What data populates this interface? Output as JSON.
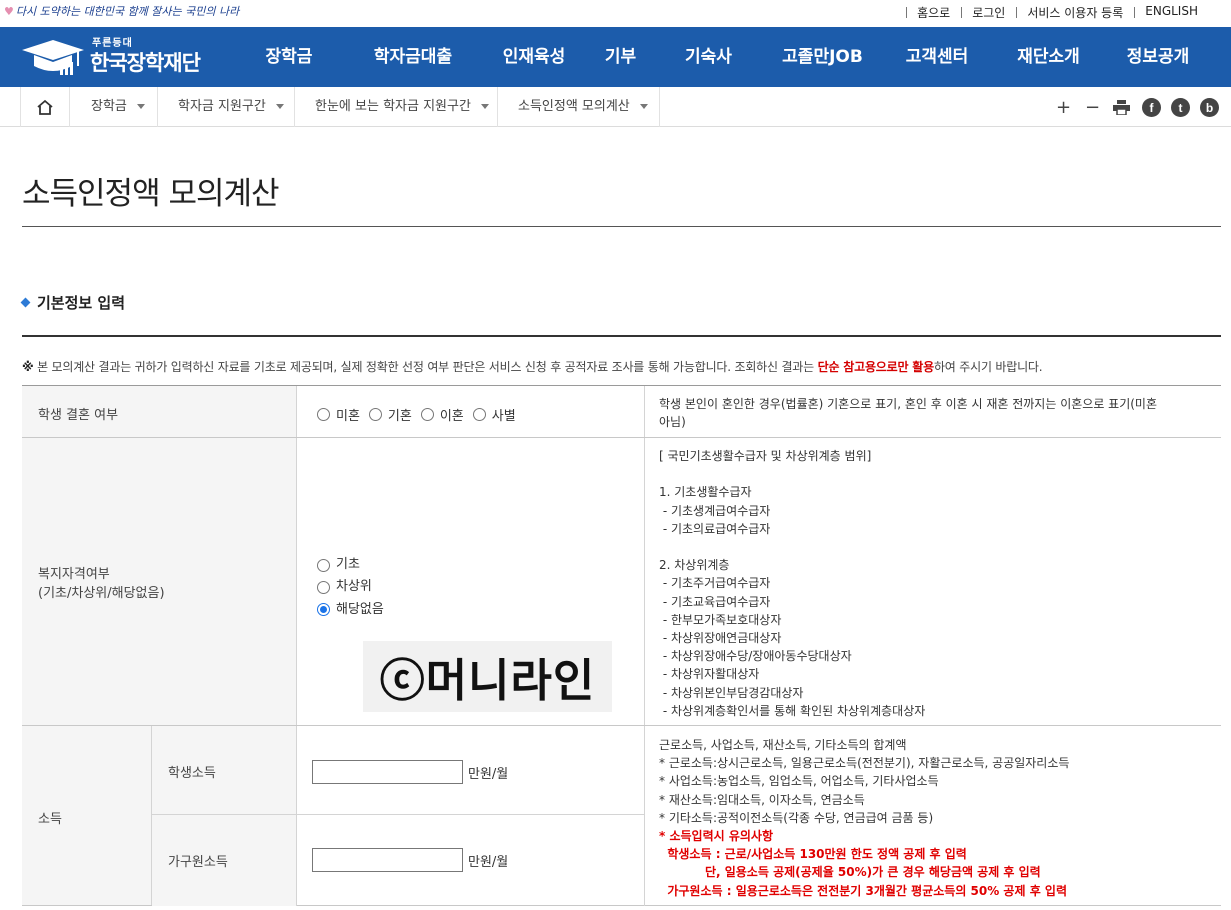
{
  "header": {
    "slogan": "다시 도약하는 대한민국 함께 잘사는 국민의 나라",
    "util_links": [
      "홈으로",
      "로그인",
      "서비스 이용자 등록",
      "ENGLISH"
    ],
    "logo_sub": "푸른등대",
    "logo_name": "한국장학재단",
    "menu": [
      "장학금",
      "학자금대출",
      "인재육성",
      "기부",
      "기숙사",
      "고졸만JOB",
      "고객센터",
      "재단소개",
      "정보공개"
    ],
    "brand_color": "#1c5cab"
  },
  "breadcrumb": {
    "items": [
      "장학금",
      "학자금 지원구간",
      "한눈에 보는 학자금 지원구간",
      "소득인정액 모의계산"
    ]
  },
  "tools": {
    "zoom_in": "+",
    "zoom_out": "−",
    "facebook": "f",
    "twitter": "t",
    "blog": "b"
  },
  "page": {
    "title": "소득인정액 모의계산",
    "section_title": "기본정보 입력",
    "notice_mark": "※",
    "notice_text": " 본 모의계산 결과는 귀하가 입력하신 자료를 기초로 제공되며, 실제 정확한 선정 여부 판단은 서비스 신청 후 공적자료 조사를 통해 가능합니다. 조회하신 결과는 ",
    "notice_red": "단순 참고용으로만 활용",
    "notice_tail": "하여 주시기 바랍니다."
  },
  "form": {
    "marriage": {
      "label": "학생 결혼 여부",
      "options": [
        "미혼",
        "기혼",
        "이혼",
        "사별"
      ],
      "selected": null,
      "desc": [
        "학생 본인이 혼인한 경우(법률혼) 기혼으로 표기, 혼인 후 이혼 시 재혼 전까지는 이혼으로 표기(미혼",
        "아님)"
      ]
    },
    "welfare": {
      "label_1": "복지자격여부",
      "label_2": "(기초/차상위/해당없음)",
      "options": [
        "기초",
        "차상위",
        "해당없음"
      ],
      "selected": "해당없음",
      "desc": [
        "[ 국민기초생활수급자 및 차상위계층 범위]",
        "",
        "1. 기초생활수급자",
        " - 기초생계급여수급자",
        " - 기초의료급여수급자",
        "",
        "2. 차상위계층",
        " - 기초주거급여수급자",
        " - 기초교육급여수급자",
        " - 한부모가족보호대상자",
        " - 차상위장애연금대상자",
        " - 차상위장애수당/장애아동수당대상자",
        " - 차상위자활대상자",
        " - 차상위본인부담경감대상자",
        " - 차상위계층확인서를 통해 확인된 차상위계층대상자"
      ]
    },
    "income": {
      "label": "소득",
      "student_label": "학생소득",
      "family_label": "가구원소득",
      "student_value": "",
      "family_value": "",
      "unit": "만원/월",
      "desc": [
        "근로소득, 사업소득, 재산소득, 기타소득의 합계액",
        "* 근로소득:상시근로소득, 일용근로소득(전전분기), 자활근로소득, 공공일자리소득",
        "* 사업소득:농업소득, 임업소득, 어업소득, 기타사업소득",
        "* 재산소득:임대소득, 이자소득, 연금소득",
        "* 기타소득:공적이전소득(각종 수당, 연금급여 금품 등)"
      ],
      "desc_red": [
        "* 소득입력시 유의사항",
        "  학생소득 : 근로/사업소득 130만원 한도 정액 공제 후 입력",
        "           단, 일용소득 공제(공제율 50%)가 큰 경우 해당금액 공제 후 입력",
        "  가구원소득 : 일용근로소득은 전전분기 3개월간 평균소득의 50% 공제 후 입력"
      ]
    }
  },
  "watermark": "ⓒ머니라인"
}
